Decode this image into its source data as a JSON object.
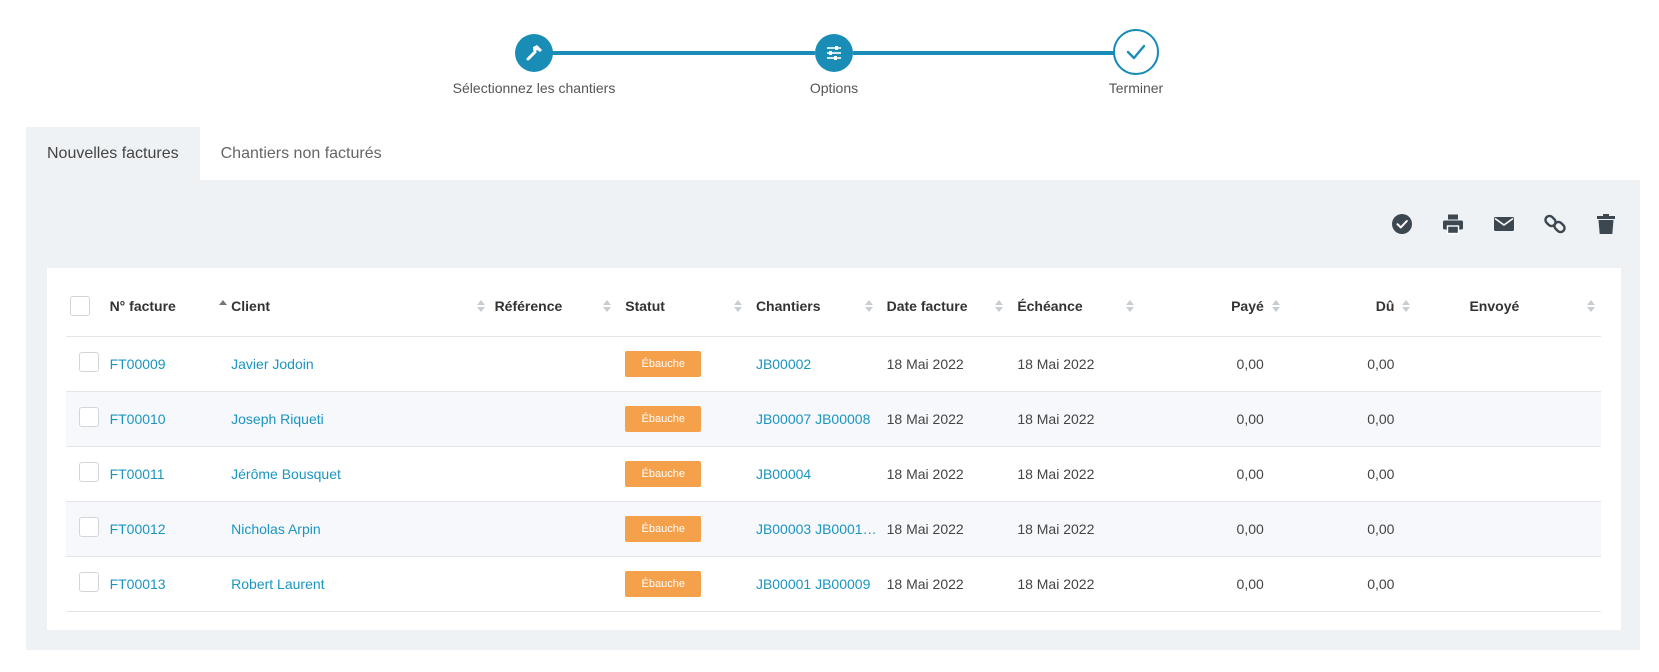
{
  "stepper": {
    "steps": [
      {
        "label": "Sélectionnez les chantiers",
        "icon": "hammer-icon"
      },
      {
        "label": "Options",
        "icon": "sliders-icon"
      },
      {
        "label": "Terminer",
        "icon": "check-icon"
      }
    ]
  },
  "tabs": [
    {
      "label": "Nouvelles factures",
      "active": true
    },
    {
      "label": "Chantiers non facturés",
      "active": false
    }
  ],
  "toolbar": {
    "icons": [
      "check-circle-icon",
      "print-icon",
      "envelope-icon",
      "link-icon",
      "trash-icon"
    ]
  },
  "table": {
    "columns": {
      "invoice": "N° facture",
      "client": "Client",
      "reference": "Référence",
      "status": "Statut",
      "sites": "Chantiers",
      "date": "Date facture",
      "due": "Échéance",
      "paid": "Payé",
      "owed": "Dû",
      "sent": "Envoyé"
    },
    "rows": [
      {
        "invoice": "FT00009",
        "client": "Javier Jodoin",
        "reference": "",
        "status": "Ébauche",
        "sites": "JB00002",
        "date": "18 Mai 2022",
        "due": "18 Mai 2022",
        "paid": "0,00",
        "owed": "0,00",
        "sent": ""
      },
      {
        "invoice": "FT00010",
        "client": "Joseph Riqueti",
        "reference": "",
        "status": "Ébauche",
        "sites": "JB00007 JB00008",
        "date": "18 Mai 2022",
        "due": "18 Mai 2022",
        "paid": "0,00",
        "owed": "0,00",
        "sent": ""
      },
      {
        "invoice": "FT00011",
        "client": "Jérôme Bousquet",
        "reference": "",
        "status": "Ébauche",
        "sites": "JB00004",
        "date": "18 Mai 2022",
        "due": "18 Mai 2022",
        "paid": "0,00",
        "owed": "0,00",
        "sent": ""
      },
      {
        "invoice": "FT00012",
        "client": "Nicholas Arpin",
        "reference": "",
        "status": "Ébauche",
        "sites": "JB00003 JB0001…",
        "date": "18 Mai 2022",
        "due": "18 Mai 2022",
        "paid": "0,00",
        "owed": "0,00",
        "sent": ""
      },
      {
        "invoice": "FT00013",
        "client": "Robert Laurent",
        "reference": "",
        "status": "Ébauche",
        "sites": "JB00001 JB00009",
        "date": "18 Mai 2022",
        "due": "18 Mai 2022",
        "paid": "0,00",
        "owed": "0,00",
        "sent": ""
      }
    ]
  },
  "colors": {
    "accent": "#1a8db7",
    "link": "#1a95c0",
    "badge": "#f5a04a",
    "panel": "#eef2f5"
  }
}
